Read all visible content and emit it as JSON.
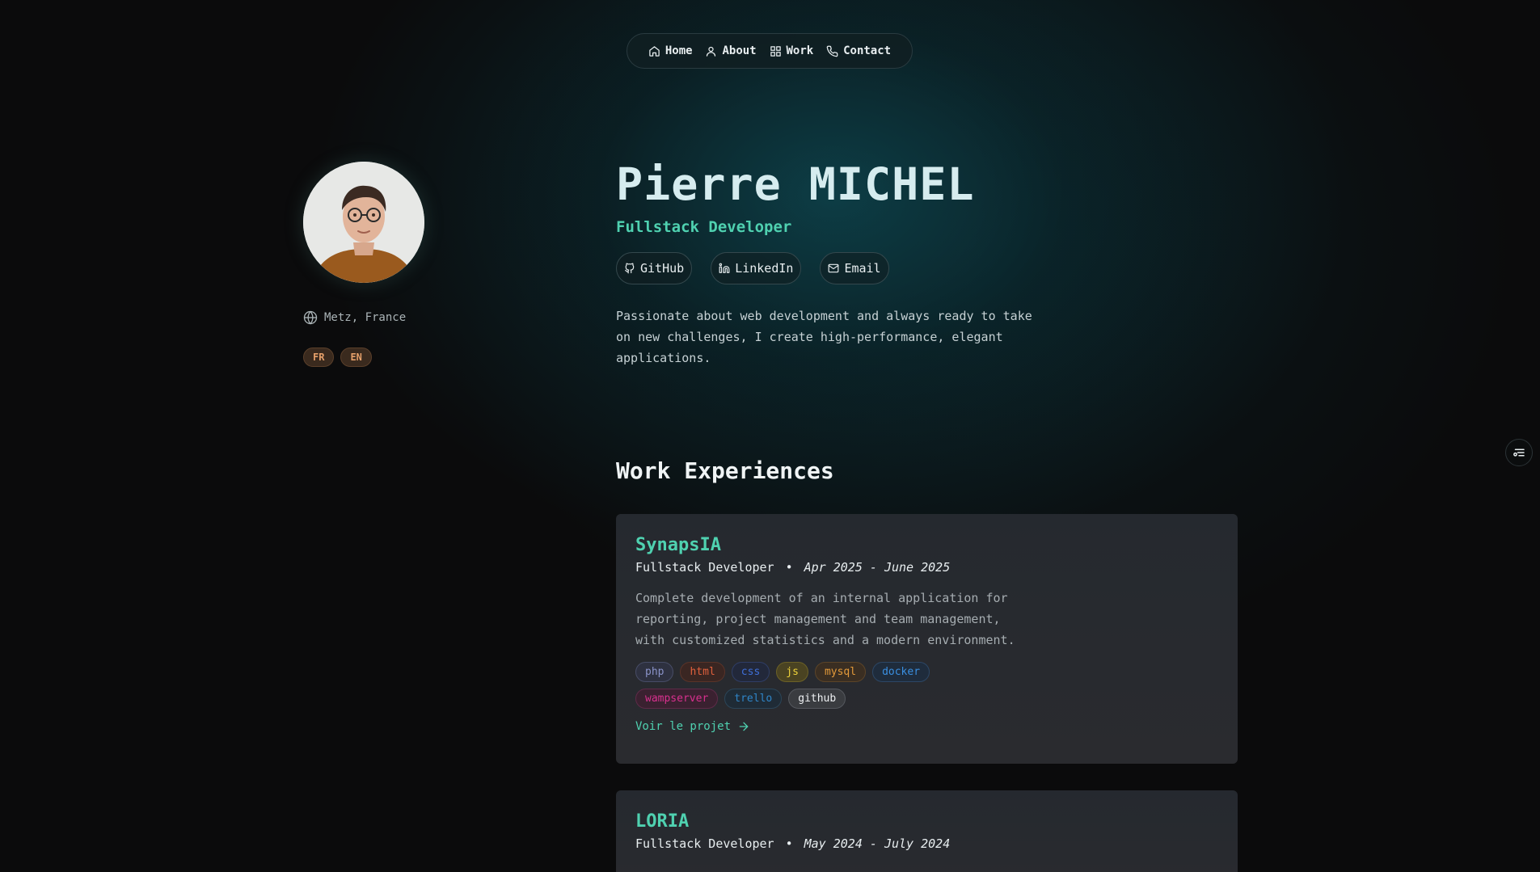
{
  "nav": {
    "items": [
      {
        "label": "Home",
        "icon": "home-icon"
      },
      {
        "label": "About",
        "icon": "user-icon"
      },
      {
        "label": "Work",
        "icon": "grid-icon"
      },
      {
        "label": "Contact",
        "icon": "phone-icon"
      }
    ]
  },
  "profile": {
    "location": "Metz, France",
    "languages": [
      "FR",
      "EN"
    ]
  },
  "hero": {
    "name": "Pierre MICHEL",
    "role": "Fullstack Developer",
    "social": [
      {
        "label": "GitHub",
        "icon": "github-icon"
      },
      {
        "label": "LinkedIn",
        "icon": "linkedin-icon"
      },
      {
        "label": "Email",
        "icon": "mail-icon"
      }
    ],
    "bio": "Passionate about web development and always ready to take on new challenges, I create high-performance, elegant applications."
  },
  "experiences": {
    "title": "Work Experiences",
    "items": [
      {
        "company": "SynapsIA",
        "role": "Fullstack Developer",
        "separator": "•",
        "dates": "Apr 2025 - June 2025",
        "description": "Complete development of an internal application for reporting, project management and team management, with customized statistics and a modern environment.",
        "tags": [
          {
            "label": "php",
            "color": "#8a93c9",
            "bg": "#2e3140",
            "border": "#474c66"
          },
          {
            "label": "html",
            "color": "#e0603c",
            "bg": "#3a2622",
            "border": "#5a3328"
          },
          {
            "label": "css",
            "color": "#3f6fd8",
            "bg": "#22283a",
            "border": "#2f3d66"
          },
          {
            "label": "js",
            "color": "#f0d43a",
            "bg": "#4a4322",
            "border": "#6c6126"
          },
          {
            "label": "mysql",
            "color": "#e39a3a",
            "bg": "#3a2e22",
            "border": "#5c4428"
          },
          {
            "label": "docker",
            "color": "#3a8fe0",
            "bg": "#1f2c3c",
            "border": "#2c4766"
          },
          {
            "label": "wampserver",
            "color": "#d9308f",
            "bg": "#3a2130",
            "border": "#5e2a48"
          },
          {
            "label": "trello",
            "color": "#2f86c9",
            "bg": "#1f2b36",
            "border": "#2b4558"
          },
          {
            "label": "github",
            "color": "#eef0f2",
            "bg": "#3a3c40",
            "border": "#55585e"
          }
        ],
        "link_label": "Voir le projet"
      },
      {
        "company": "LORIA",
        "role": "Fullstack Developer",
        "separator": "•",
        "dates": "May 2024 - July 2024"
      }
    ]
  },
  "colors": {
    "accent": "#4fd1b0",
    "background": "#0b0b0c",
    "card": "#27292e",
    "lang_badge": "#e6a06a"
  }
}
